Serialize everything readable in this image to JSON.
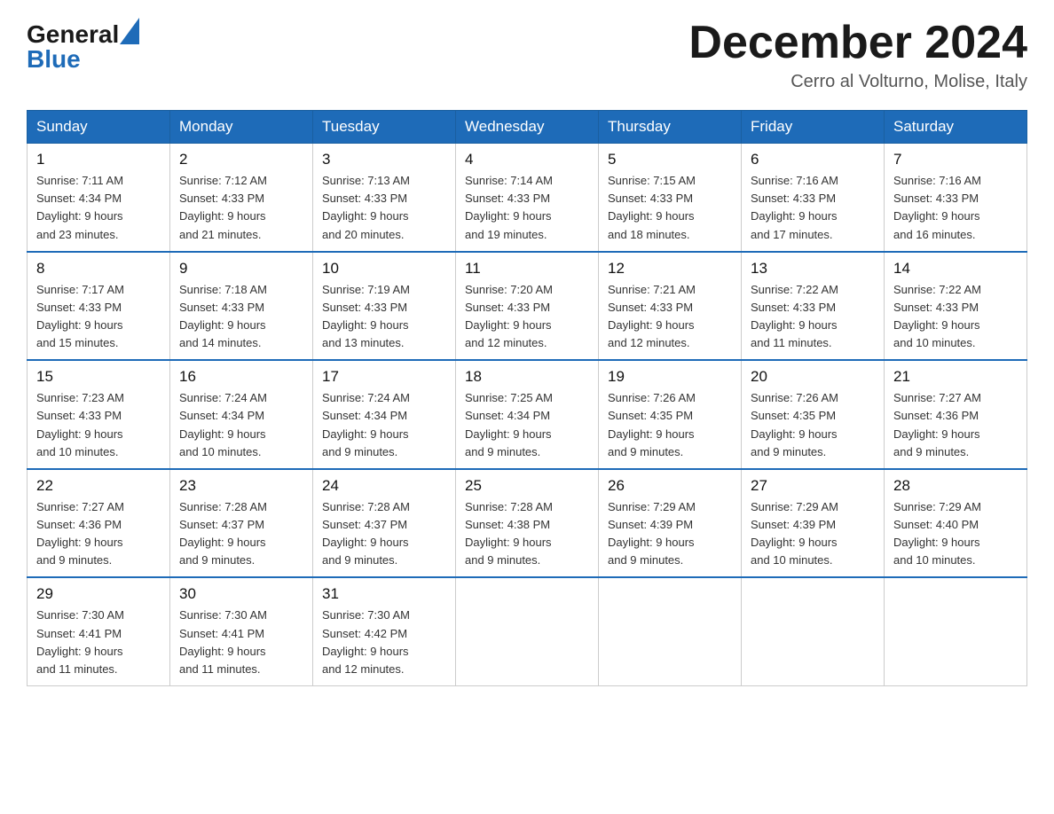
{
  "header": {
    "logo_general": "General",
    "logo_blue": "Blue",
    "main_title": "December 2024",
    "subtitle": "Cerro al Volturno, Molise, Italy"
  },
  "weekdays": [
    "Sunday",
    "Monday",
    "Tuesday",
    "Wednesday",
    "Thursday",
    "Friday",
    "Saturday"
  ],
  "weeks": [
    [
      {
        "day": "1",
        "sunrise": "7:11 AM",
        "sunset": "4:34 PM",
        "daylight": "9 hours and 23 minutes."
      },
      {
        "day": "2",
        "sunrise": "7:12 AM",
        "sunset": "4:33 PM",
        "daylight": "9 hours and 21 minutes."
      },
      {
        "day": "3",
        "sunrise": "7:13 AM",
        "sunset": "4:33 PM",
        "daylight": "9 hours and 20 minutes."
      },
      {
        "day": "4",
        "sunrise": "7:14 AM",
        "sunset": "4:33 PM",
        "daylight": "9 hours and 19 minutes."
      },
      {
        "day": "5",
        "sunrise": "7:15 AM",
        "sunset": "4:33 PM",
        "daylight": "9 hours and 18 minutes."
      },
      {
        "day": "6",
        "sunrise": "7:16 AM",
        "sunset": "4:33 PM",
        "daylight": "9 hours and 17 minutes."
      },
      {
        "day": "7",
        "sunrise": "7:16 AM",
        "sunset": "4:33 PM",
        "daylight": "9 hours and 16 minutes."
      }
    ],
    [
      {
        "day": "8",
        "sunrise": "7:17 AM",
        "sunset": "4:33 PM",
        "daylight": "9 hours and 15 minutes."
      },
      {
        "day": "9",
        "sunrise": "7:18 AM",
        "sunset": "4:33 PM",
        "daylight": "9 hours and 14 minutes."
      },
      {
        "day": "10",
        "sunrise": "7:19 AM",
        "sunset": "4:33 PM",
        "daylight": "9 hours and 13 minutes."
      },
      {
        "day": "11",
        "sunrise": "7:20 AM",
        "sunset": "4:33 PM",
        "daylight": "9 hours and 12 minutes."
      },
      {
        "day": "12",
        "sunrise": "7:21 AM",
        "sunset": "4:33 PM",
        "daylight": "9 hours and 12 minutes."
      },
      {
        "day": "13",
        "sunrise": "7:22 AM",
        "sunset": "4:33 PM",
        "daylight": "9 hours and 11 minutes."
      },
      {
        "day": "14",
        "sunrise": "7:22 AM",
        "sunset": "4:33 PM",
        "daylight": "9 hours and 10 minutes."
      }
    ],
    [
      {
        "day": "15",
        "sunrise": "7:23 AM",
        "sunset": "4:33 PM",
        "daylight": "9 hours and 10 minutes."
      },
      {
        "day": "16",
        "sunrise": "7:24 AM",
        "sunset": "4:34 PM",
        "daylight": "9 hours and 10 minutes."
      },
      {
        "day": "17",
        "sunrise": "7:24 AM",
        "sunset": "4:34 PM",
        "daylight": "9 hours and 9 minutes."
      },
      {
        "day": "18",
        "sunrise": "7:25 AM",
        "sunset": "4:34 PM",
        "daylight": "9 hours and 9 minutes."
      },
      {
        "day": "19",
        "sunrise": "7:26 AM",
        "sunset": "4:35 PM",
        "daylight": "9 hours and 9 minutes."
      },
      {
        "day": "20",
        "sunrise": "7:26 AM",
        "sunset": "4:35 PM",
        "daylight": "9 hours and 9 minutes."
      },
      {
        "day": "21",
        "sunrise": "7:27 AM",
        "sunset": "4:36 PM",
        "daylight": "9 hours and 9 minutes."
      }
    ],
    [
      {
        "day": "22",
        "sunrise": "7:27 AM",
        "sunset": "4:36 PM",
        "daylight": "9 hours and 9 minutes."
      },
      {
        "day": "23",
        "sunrise": "7:28 AM",
        "sunset": "4:37 PM",
        "daylight": "9 hours and 9 minutes."
      },
      {
        "day": "24",
        "sunrise": "7:28 AM",
        "sunset": "4:37 PM",
        "daylight": "9 hours and 9 minutes."
      },
      {
        "day": "25",
        "sunrise": "7:28 AM",
        "sunset": "4:38 PM",
        "daylight": "9 hours and 9 minutes."
      },
      {
        "day": "26",
        "sunrise": "7:29 AM",
        "sunset": "4:39 PM",
        "daylight": "9 hours and 9 minutes."
      },
      {
        "day": "27",
        "sunrise": "7:29 AM",
        "sunset": "4:39 PM",
        "daylight": "9 hours and 10 minutes."
      },
      {
        "day": "28",
        "sunrise": "7:29 AM",
        "sunset": "4:40 PM",
        "daylight": "9 hours and 10 minutes."
      }
    ],
    [
      {
        "day": "29",
        "sunrise": "7:30 AM",
        "sunset": "4:41 PM",
        "daylight": "9 hours and 11 minutes."
      },
      {
        "day": "30",
        "sunrise": "7:30 AM",
        "sunset": "4:41 PM",
        "daylight": "9 hours and 11 minutes."
      },
      {
        "day": "31",
        "sunrise": "7:30 AM",
        "sunset": "4:42 PM",
        "daylight": "9 hours and 12 minutes."
      },
      null,
      null,
      null,
      null
    ]
  ],
  "labels": {
    "sunrise": "Sunrise:",
    "sunset": "Sunset:",
    "daylight": "Daylight:"
  }
}
